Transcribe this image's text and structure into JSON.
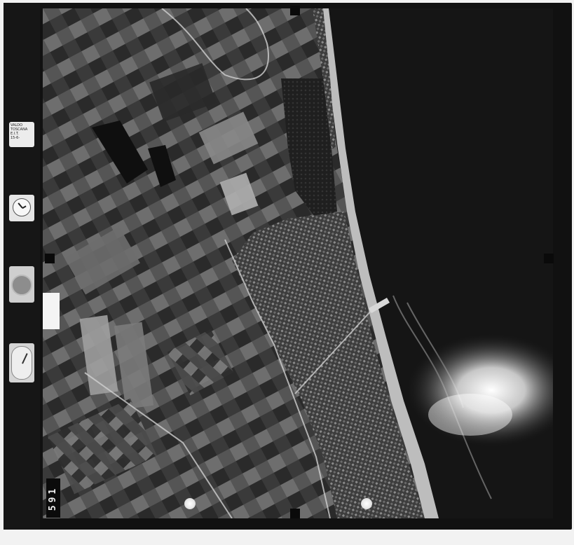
{
  "photo": {
    "frame_number": "591",
    "label_card_lines": [
      "VALDO",
      "TOSCANA",
      "E.I.T.",
      "15-6-"
    ],
    "colors": {
      "film_border": "#111111",
      "sea": "#151515",
      "beach": "#bdbdbd",
      "sun_glint": "#ffffff",
      "fields_dark": "#2b2b2b",
      "fields_light": "#8a8a8a",
      "urban": "#5a5a5a"
    },
    "instruments": [
      "clock-icon",
      "compass-icon",
      "altimeter-icon"
    ]
  }
}
